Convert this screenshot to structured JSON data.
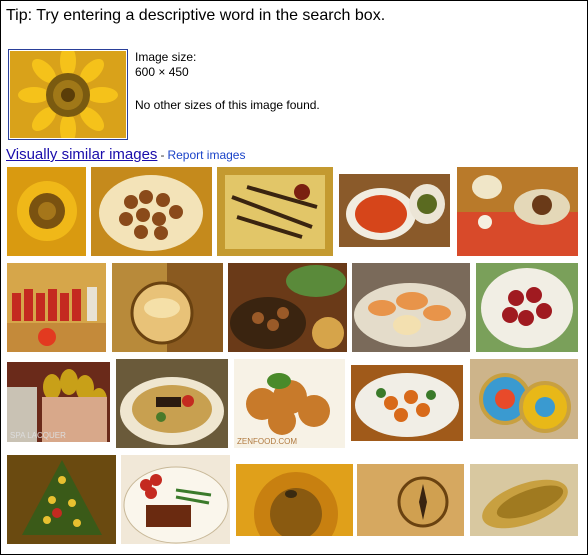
{
  "tip": "Tip: Try entering a descriptive word in the search box.",
  "query_image": {
    "alt": "sunflower",
    "size_label": "Image size:",
    "size_value": "600 × 450",
    "no_other_sizes": "No other sizes of this image found."
  },
  "similar": {
    "title": "Visually similar images",
    "separator": "-",
    "report": "Report images"
  },
  "thumbnails": [
    {
      "name": "sunflower"
    },
    {
      "name": "chestnuts-plate"
    },
    {
      "name": "grilled-skewers"
    },
    {
      "name": "soup-bowl"
    },
    {
      "name": "dinner-table"
    },
    {
      "name": "team-photo"
    },
    {
      "name": "glass-bowl"
    },
    {
      "name": "stir-fry"
    },
    {
      "name": "seafood-platter"
    },
    {
      "name": "red-octopus-plate"
    },
    {
      "name": "gold-nail-polish"
    },
    {
      "name": "noodle-bowl"
    },
    {
      "name": "fried-chicken"
    },
    {
      "name": "salad-plate"
    },
    {
      "name": "badges"
    },
    {
      "name": "christmas-tree"
    },
    {
      "name": "tomato-steak-plate"
    },
    {
      "name": "sunflower-bee"
    },
    {
      "name": "compass"
    },
    {
      "name": "golden-leaves"
    }
  ],
  "stamps": {
    "food_photo": "ZENFOOD.COM",
    "polish": "SPA LACQUER"
  }
}
